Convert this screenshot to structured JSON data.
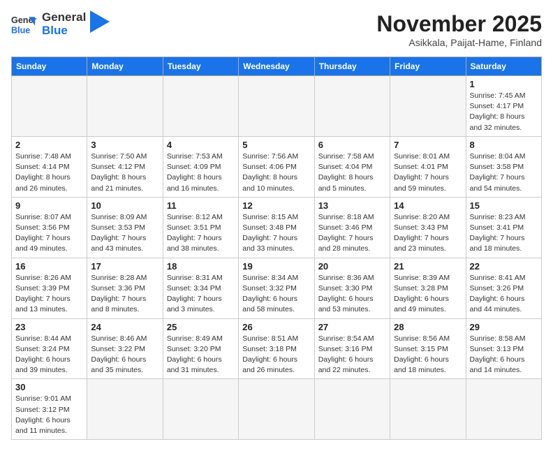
{
  "logo": {
    "line1": "General",
    "line2": "Blue"
  },
  "title": "November 2025",
  "location": "Asikkala, Paijat-Hame, Finland",
  "headers": [
    "Sunday",
    "Monday",
    "Tuesday",
    "Wednesday",
    "Thursday",
    "Friday",
    "Saturday"
  ],
  "weeks": [
    [
      {
        "day": "",
        "info": ""
      },
      {
        "day": "",
        "info": ""
      },
      {
        "day": "",
        "info": ""
      },
      {
        "day": "",
        "info": ""
      },
      {
        "day": "",
        "info": ""
      },
      {
        "day": "",
        "info": ""
      },
      {
        "day": "1",
        "info": "Sunrise: 7:45 AM\nSunset: 4:17 PM\nDaylight: 8 hours\nand 32 minutes."
      }
    ],
    [
      {
        "day": "2",
        "info": "Sunrise: 7:48 AM\nSunset: 4:14 PM\nDaylight: 8 hours\nand 26 minutes."
      },
      {
        "day": "3",
        "info": "Sunrise: 7:50 AM\nSunset: 4:12 PM\nDaylight: 8 hours\nand 21 minutes."
      },
      {
        "day": "4",
        "info": "Sunrise: 7:53 AM\nSunset: 4:09 PM\nDaylight: 8 hours\nand 16 minutes."
      },
      {
        "day": "5",
        "info": "Sunrise: 7:56 AM\nSunset: 4:06 PM\nDaylight: 8 hours\nand 10 minutes."
      },
      {
        "day": "6",
        "info": "Sunrise: 7:58 AM\nSunset: 4:04 PM\nDaylight: 8 hours\nand 5 minutes."
      },
      {
        "day": "7",
        "info": "Sunrise: 8:01 AM\nSunset: 4:01 PM\nDaylight: 7 hours\nand 59 minutes."
      },
      {
        "day": "8",
        "info": "Sunrise: 8:04 AM\nSunset: 3:58 PM\nDaylight: 7 hours\nand 54 minutes."
      }
    ],
    [
      {
        "day": "9",
        "info": "Sunrise: 8:07 AM\nSunset: 3:56 PM\nDaylight: 7 hours\nand 49 minutes."
      },
      {
        "day": "10",
        "info": "Sunrise: 8:09 AM\nSunset: 3:53 PM\nDaylight: 7 hours\nand 43 minutes."
      },
      {
        "day": "11",
        "info": "Sunrise: 8:12 AM\nSunset: 3:51 PM\nDaylight: 7 hours\nand 38 minutes."
      },
      {
        "day": "12",
        "info": "Sunrise: 8:15 AM\nSunset: 3:48 PM\nDaylight: 7 hours\nand 33 minutes."
      },
      {
        "day": "13",
        "info": "Sunrise: 8:18 AM\nSunset: 3:46 PM\nDaylight: 7 hours\nand 28 minutes."
      },
      {
        "day": "14",
        "info": "Sunrise: 8:20 AM\nSunset: 3:43 PM\nDaylight: 7 hours\nand 23 minutes."
      },
      {
        "day": "15",
        "info": "Sunrise: 8:23 AM\nSunset: 3:41 PM\nDaylight: 7 hours\nand 18 minutes."
      }
    ],
    [
      {
        "day": "16",
        "info": "Sunrise: 8:26 AM\nSunset: 3:39 PM\nDaylight: 7 hours\nand 13 minutes."
      },
      {
        "day": "17",
        "info": "Sunrise: 8:28 AM\nSunset: 3:36 PM\nDaylight: 7 hours\nand 8 minutes."
      },
      {
        "day": "18",
        "info": "Sunrise: 8:31 AM\nSunset: 3:34 PM\nDaylight: 7 hours\nand 3 minutes."
      },
      {
        "day": "19",
        "info": "Sunrise: 8:34 AM\nSunset: 3:32 PM\nDaylight: 6 hours\nand 58 minutes."
      },
      {
        "day": "20",
        "info": "Sunrise: 8:36 AM\nSunset: 3:30 PM\nDaylight: 6 hours\nand 53 minutes."
      },
      {
        "day": "21",
        "info": "Sunrise: 8:39 AM\nSunset: 3:28 PM\nDaylight: 6 hours\nand 49 minutes."
      },
      {
        "day": "22",
        "info": "Sunrise: 8:41 AM\nSunset: 3:26 PM\nDaylight: 6 hours\nand 44 minutes."
      }
    ],
    [
      {
        "day": "23",
        "info": "Sunrise: 8:44 AM\nSunset: 3:24 PM\nDaylight: 6 hours\nand 39 minutes."
      },
      {
        "day": "24",
        "info": "Sunrise: 8:46 AM\nSunset: 3:22 PM\nDaylight: 6 hours\nand 35 minutes."
      },
      {
        "day": "25",
        "info": "Sunrise: 8:49 AM\nSunset: 3:20 PM\nDaylight: 6 hours\nand 31 minutes."
      },
      {
        "day": "26",
        "info": "Sunrise: 8:51 AM\nSunset: 3:18 PM\nDaylight: 6 hours\nand 26 minutes."
      },
      {
        "day": "27",
        "info": "Sunrise: 8:54 AM\nSunset: 3:16 PM\nDaylight: 6 hours\nand 22 minutes."
      },
      {
        "day": "28",
        "info": "Sunrise: 8:56 AM\nSunset: 3:15 PM\nDaylight: 6 hours\nand 18 minutes."
      },
      {
        "day": "29",
        "info": "Sunrise: 8:58 AM\nSunset: 3:13 PM\nDaylight: 6 hours\nand 14 minutes."
      }
    ],
    [
      {
        "day": "30",
        "info": "Sunrise: 9:01 AM\nSunset: 3:12 PM\nDaylight: 6 hours\nand 11 minutes."
      },
      {
        "day": "",
        "info": ""
      },
      {
        "day": "",
        "info": ""
      },
      {
        "day": "",
        "info": ""
      },
      {
        "day": "",
        "info": ""
      },
      {
        "day": "",
        "info": ""
      },
      {
        "day": "",
        "info": ""
      }
    ]
  ]
}
